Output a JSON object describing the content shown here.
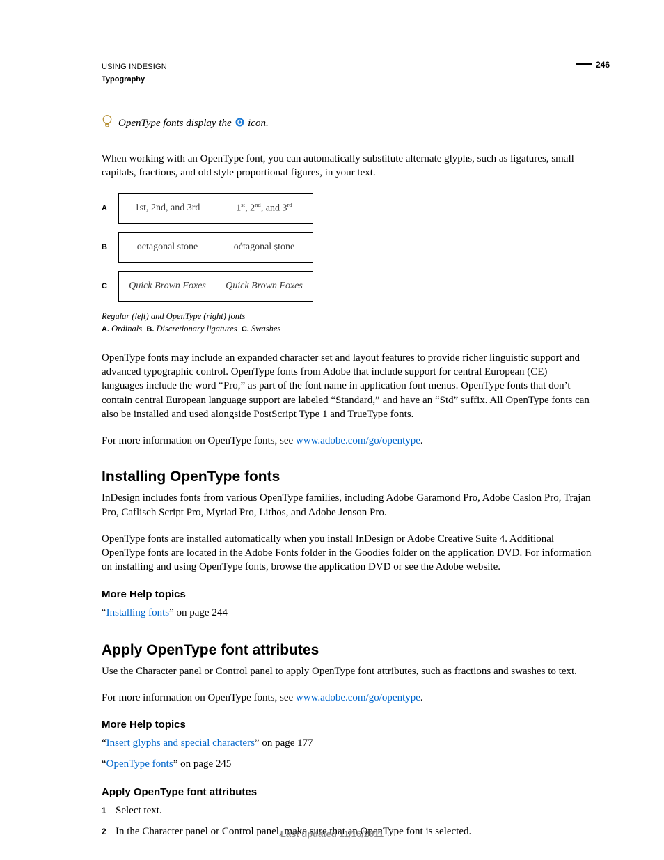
{
  "page_number": "246",
  "running_head": {
    "line1": "USING INDESIGN",
    "line2": "Typography"
  },
  "tip": {
    "prefix": "OpenType fonts display the ",
    "suffix": " icon."
  },
  "intro_para": "When working with an OpenType font, you can automatically substitute alternate glyphs, such as ligatures, small capitals, fractions, and old style proportional figures, in your text.",
  "figure": {
    "rows": [
      {
        "label": "A",
        "left": "1st, 2nd, and 3rd",
        "right_html": "1<sup>st</sup>, 2<sup>nd</sup>, and 3<sup>rd</sup>",
        "style": "plain"
      },
      {
        "label": "B",
        "left": "octagonal stone",
        "right": "oćtagonal ştone",
        "style": "plain"
      },
      {
        "label": "C",
        "left": "Quick Brown Foxes",
        "right": "Quick Brown Foxes",
        "style": "script"
      }
    ],
    "caption_line1": "Regular (left) and OpenType (right) fonts",
    "caption_keys": [
      {
        "k": "A.",
        "v": "Ordinals"
      },
      {
        "k": "B.",
        "v": "Discretionary ligatures"
      },
      {
        "k": "C.",
        "v": "Swashes"
      }
    ]
  },
  "after_figure_para": "OpenType fonts may include an expanded character set and layout features to provide richer linguistic support and advanced typographic control. OpenType fonts from Adobe that include support for central European (CE) languages include the word “Pro,” as part of the font name in application font menus. OpenType fonts that don’t contain central European language support are labeled “Standard,” and have an “Std” suffix. All OpenType fonts can also be installed and used alongside PostScript Type 1 and TrueType fonts.",
  "moreinfo_prefix": "For more information on OpenType fonts, see ",
  "moreinfo_link": "www.adobe.com/go/opentype",
  "moreinfo_suffix": ".",
  "section1": {
    "title": "Installing OpenType fonts",
    "p1": "InDesign includes fonts from various OpenType families, including Adobe Garamond Pro, Adobe Caslon Pro, Trajan Pro, Caflisch Script Pro, Myriad Pro, Lithos, and Adobe Jenson Pro.",
    "p2": "OpenType fonts are installed automatically when you install InDesign or Adobe Creative Suite 4. Additional OpenType fonts are located in the Adobe Fonts folder in the Goodies folder on the application DVD. For information on installing and using OpenType fonts, browse the application DVD or see the Adobe website.",
    "more_title": "More Help topics",
    "xref_link": "Installing fonts",
    "xref_suffix": "” on page 244"
  },
  "section2": {
    "title": "Apply OpenType font attributes",
    "p1": "Use the Character panel or Control panel to apply OpenType font attributes, such as fractions and swashes to text.",
    "more_title": "More Help topics",
    "xref1_link": "Insert glyphs and special characters",
    "xref1_suffix": "” on page 177",
    "xref2_link": "OpenType fonts",
    "xref2_suffix": "” on page 245",
    "task_title": "Apply OpenType font attributes",
    "steps": [
      "Select text.",
      "In the Character panel or Control panel, make sure that an OpenType font is selected."
    ]
  },
  "footer": "Last updated 11/16/2011"
}
